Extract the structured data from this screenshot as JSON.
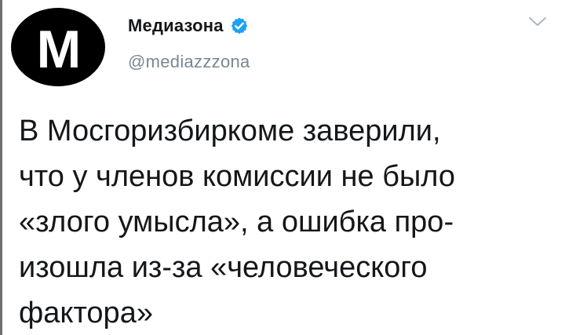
{
  "author": {
    "avatar_letter": "M",
    "display_name": "Медиазона",
    "handle": "@mediazzzona",
    "verified_icon": "verified-badge-icon",
    "verified_color": "#1da1f2"
  },
  "menu": {
    "icon": "chevron-down-icon"
  },
  "tweet": {
    "lines": [
      "В Мосгоризбиркоме заверили,",
      "что у членов комиссии не было",
      "«злого умысла», а ошибка про-",
      "изошла из-за «человеческого",
      "фактора»"
    ]
  }
}
